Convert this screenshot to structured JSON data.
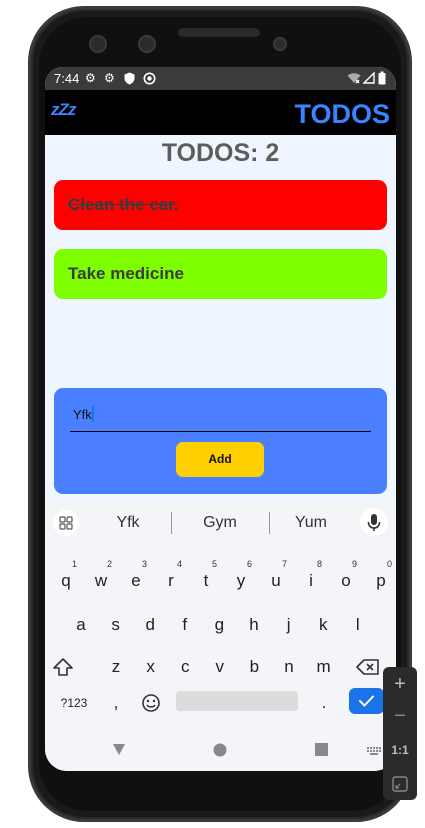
{
  "status_bar": {
    "time": "7:44",
    "icons": [
      "gear-icon",
      "gear-icon",
      "shield-icon",
      "circle-a-icon",
      "wifi-icon",
      "signal-icon",
      "battery-icon"
    ]
  },
  "app_bar": {
    "logo": "zZz",
    "title": "TODOS",
    "accent_color": "#3a84ff"
  },
  "counter": "TODOS: 2",
  "todos": [
    {
      "text": "Clean the car.",
      "done": true,
      "color": "#ff0000"
    },
    {
      "text": "Take medicine",
      "done": false,
      "color": "#7dff00"
    }
  ],
  "add_form": {
    "input_value": "Yfk",
    "button_label": "Add",
    "panel_color": "#4a80ff",
    "button_color": "#ffd000"
  },
  "keyboard": {
    "suggestions": [
      "Yfk",
      "Gym",
      "Yum"
    ],
    "row1": [
      {
        "k": "q",
        "h": "1"
      },
      {
        "k": "w",
        "h": "2"
      },
      {
        "k": "e",
        "h": "3"
      },
      {
        "k": "r",
        "h": "4"
      },
      {
        "k": "t",
        "h": "5"
      },
      {
        "k": "y",
        "h": "6"
      },
      {
        "k": "u",
        "h": "7"
      },
      {
        "k": "i",
        "h": "8"
      },
      {
        "k": "o",
        "h": "9"
      },
      {
        "k": "p",
        "h": "0"
      }
    ],
    "row2": [
      "a",
      "s",
      "d",
      "f",
      "g",
      "h",
      "j",
      "k",
      "l"
    ],
    "row3": [
      "z",
      "x",
      "c",
      "v",
      "b",
      "n",
      "m"
    ],
    "symbols_label": "?123",
    "comma": ",",
    "period": "."
  },
  "side_toolbar": {
    "ratio_label": "1:1"
  }
}
